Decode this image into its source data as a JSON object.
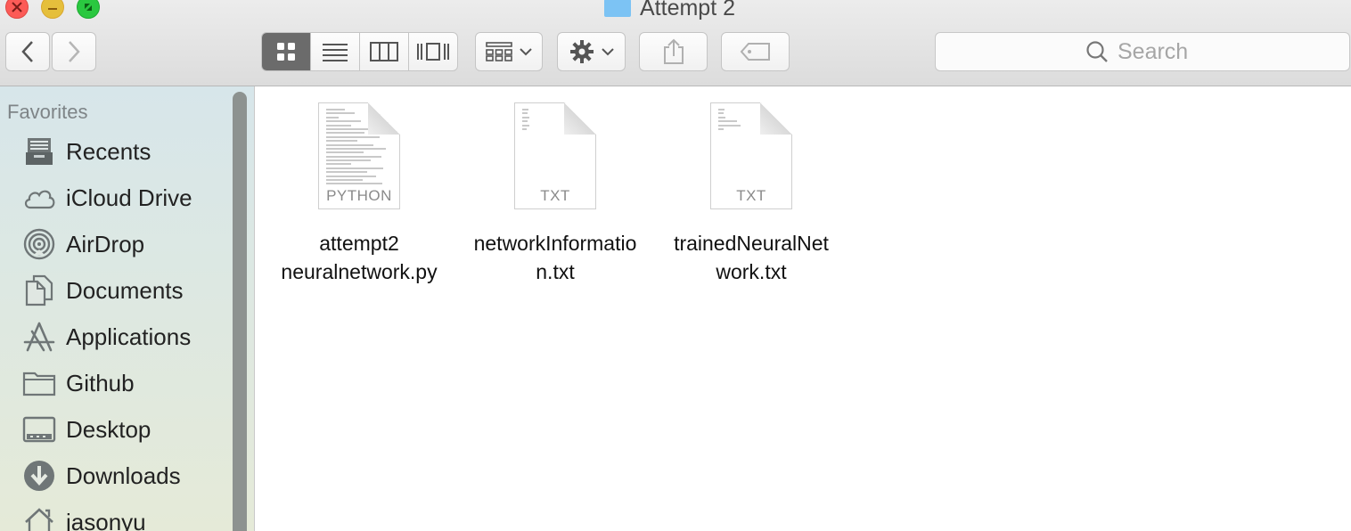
{
  "window": {
    "title": "Attempt 2"
  },
  "toolbar": {
    "back": "back",
    "forward": "forward",
    "view_modes": [
      "icon-view",
      "list-view",
      "column-view",
      "cover-flow-view"
    ],
    "active_view": "icon-view",
    "search_placeholder": "Search"
  },
  "sidebar": {
    "heading": "Favorites",
    "items": [
      {
        "label": "Recents",
        "icon": "recents-icon"
      },
      {
        "label": "iCloud Drive",
        "icon": "icloud-icon"
      },
      {
        "label": "AirDrop",
        "icon": "airdrop-icon"
      },
      {
        "label": "Documents",
        "icon": "documents-icon"
      },
      {
        "label": "Applications",
        "icon": "applications-icon"
      },
      {
        "label": "Github",
        "icon": "folder-icon"
      },
      {
        "label": "Desktop",
        "icon": "desktop-icon"
      },
      {
        "label": "Downloads",
        "icon": "downloads-icon"
      },
      {
        "label": "jasonyu",
        "icon": "home-icon"
      }
    ]
  },
  "files": [
    {
      "name_line1": "attempt2",
      "name_line2": "neuralnetwork.py",
      "ext": "PYTHON"
    },
    {
      "name_line1": "networkInformatio",
      "name_line2": "n.txt",
      "ext": "TXT"
    },
    {
      "name_line1": "trainedNeuralNet",
      "name_line2": "work.txt",
      "ext": "TXT"
    }
  ],
  "colors": {
    "folder_blue": "#7cc3f4",
    "close": "#fc5b57",
    "minimize": "#e5bf3c",
    "maximize": "#2ac840"
  }
}
